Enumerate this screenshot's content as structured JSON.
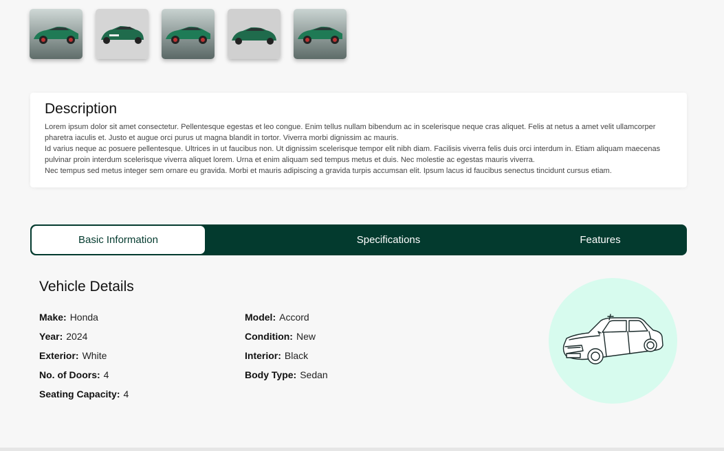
{
  "gallery": {
    "thumbnails": [
      {
        "icon": "car-side-photo"
      },
      {
        "icon": "car-front-photo"
      },
      {
        "icon": "car-side-photo"
      },
      {
        "icon": "car-front-photo"
      },
      {
        "icon": "car-side-photo"
      }
    ]
  },
  "description": {
    "title": "Description",
    "paragraphs": [
      "Lorem ipsum dolor sit amet consectetur. Pellentesque egestas et leo congue. Enim tellus nullam bibendum ac in scelerisque neque cras aliquet. Felis at netus a amet velit ullamcorper pharetra iaculis et. Justo et augue orci purus ut magna blandit in tortor. Viverra morbi dignissim ac mauris.",
      "Id varius neque ac posuere pellentesque. Ultrices in ut faucibus non. Ut dignissim scelerisque tempor elit nibh diam. Facilisis viverra felis duis orci interdum in. Etiam aliquam maecenas pulvinar proin interdum scelerisque viverra aliquet lorem. Urna et enim aliquam sed tempus metus et duis. Nec molestie ac egestas mauris viverra.",
      "Nec tempus sed metus integer sem ornare eu gravida. Morbi et mauris adipiscing a gravida turpis accumsan elit. Ipsum lacus id faucibus senectus tincidunt cursus etiam."
    ]
  },
  "tabs": [
    {
      "label": "Basic Information",
      "active": true
    },
    {
      "label": "Specifications",
      "active": false
    },
    {
      "label": "Features",
      "active": false
    }
  ],
  "vehicle": {
    "title": "Vehicle Details",
    "left": [
      {
        "key": "Make:",
        "value": "Honda"
      },
      {
        "key": "Year:",
        "value": "2024"
      },
      {
        "key": "Exterior:",
        "value": "White"
      },
      {
        "key": "No. of Doors:",
        "value": "4"
      },
      {
        "key": "Seating Capacity:",
        "value": "4"
      }
    ],
    "right": [
      {
        "key": "Model:",
        "value": "Accord"
      },
      {
        "key": "Condition:",
        "value": "New"
      },
      {
        "key": "Interior:",
        "value": "Black"
      },
      {
        "key": "Body Type:",
        "value": "Sedan"
      }
    ],
    "illustration_icon": "sedan-line-art-icon"
  },
  "colors": {
    "accent": "#033a2e",
    "circle": "#d7fbee",
    "car_green": "#1f7a55"
  }
}
